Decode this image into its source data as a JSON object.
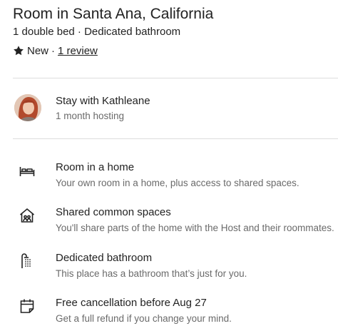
{
  "listing": {
    "title": "Room in Santa Ana, California",
    "subtitle": "1 double bed · Dedicated bathroom",
    "rating_label": "New",
    "separator": "·",
    "review_link": "1 review",
    "icons": {
      "rating": "star-icon"
    }
  },
  "host": {
    "name": "Stay with Kathleane",
    "meta": "1 month hosting",
    "avatar_icon": "host-avatar"
  },
  "features": [
    {
      "icon": "bed-icon",
      "title": "Room in a home",
      "description": "Your own room in a home, plus access to shared spaces."
    },
    {
      "icon": "home-icon",
      "title": "Shared common spaces",
      "description": "You'll share parts of the home with the Host and their roommates."
    },
    {
      "icon": "shower-icon",
      "title": "Dedicated bathroom",
      "description": "This place has a bathroom that’s just for you."
    },
    {
      "icon": "calendar-icon",
      "title": "Free cancellation before Aug 27",
      "description": "Get a full refund if you change your mind."
    }
  ]
}
